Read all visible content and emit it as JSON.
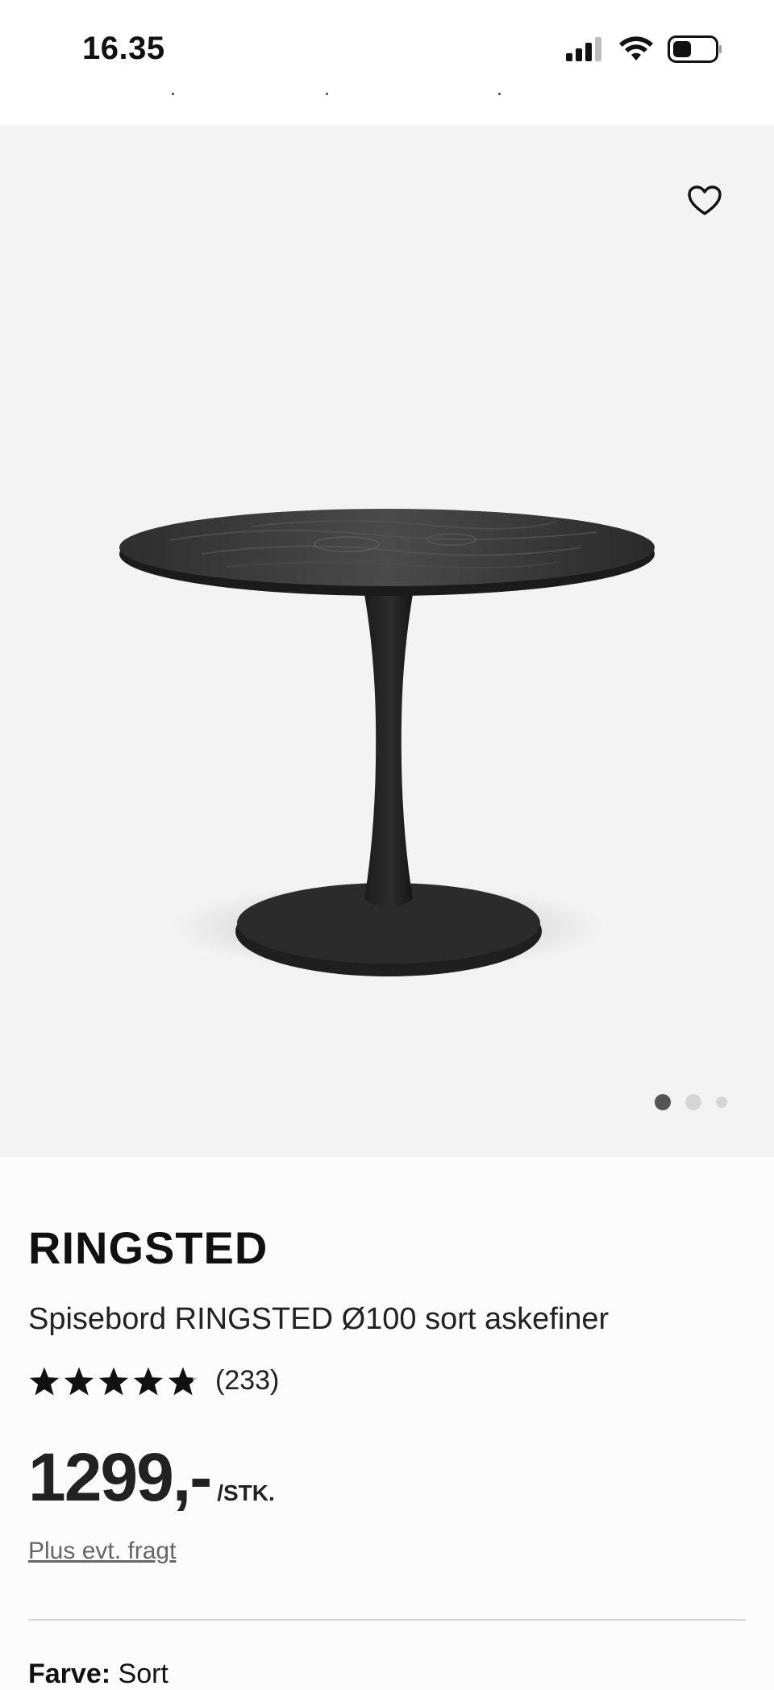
{
  "status_bar": {
    "time": "16.35",
    "icons": [
      "cellular-signal-icon",
      "wifi-icon",
      "battery-icon"
    ]
  },
  "gallery": {
    "favorite_icon": "heart-outline-icon",
    "image": "black round pedestal dining table",
    "slide_count": 3,
    "active_slide": 1
  },
  "product": {
    "brand": "RINGSTED",
    "subtitle": "Spisebord RINGSTED Ø100 sort askefiner",
    "rating": {
      "stars": 4.8,
      "max": 5,
      "count_label": "(233)"
    },
    "price": "1299,-",
    "unit": "/STK.",
    "freight_link": "Plus evt. fragt",
    "color_label": "Farve:",
    "color_value": "Sort"
  },
  "colors": {
    "star": "#111111",
    "gallery_bg": "#f3f3f3",
    "dot_active": "#555555",
    "dot_inactive": "#d5d5d5"
  }
}
